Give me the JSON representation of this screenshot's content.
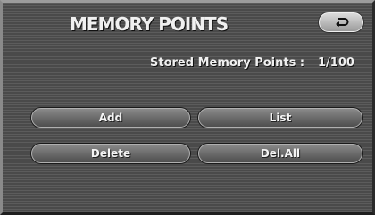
{
  "header": {
    "title": "MEMORY POINTS",
    "back_icon": "return-arrow-icon"
  },
  "stored": {
    "label": "Stored Memory Points :",
    "value": "1/100"
  },
  "buttons": {
    "add": "Add",
    "list": "List",
    "delete": "Delete",
    "delete_all": "Del.All"
  }
}
